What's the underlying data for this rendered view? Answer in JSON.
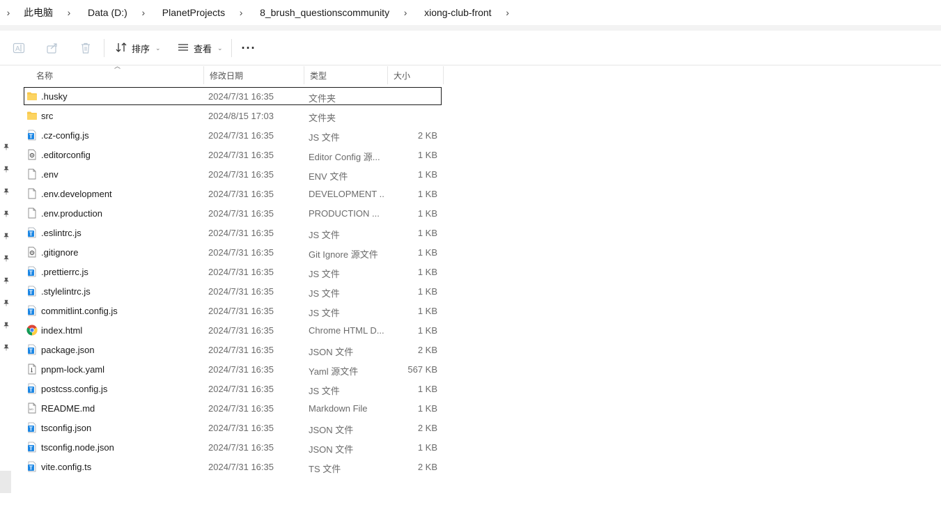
{
  "breadcrumb": {
    "items": [
      "此电脑",
      "Data (D:)",
      "PlanetProjects",
      "8_brush_questionscommunity",
      "xiong-club-front"
    ]
  },
  "toolbar": {
    "sort_label": "排序",
    "view_label": "查看",
    "more_label": "···"
  },
  "columns": {
    "name": "名称",
    "modified": "修改日期",
    "type": "类型",
    "size": "大小"
  },
  "files": [
    {
      "name": ".husky",
      "date": "2024/7/31 16:35",
      "type": "文件夹",
      "size": "",
      "icon": "folder-icon",
      "selected": true
    },
    {
      "name": "src",
      "date": "2024/8/15 17:03",
      "type": "文件夹",
      "size": "",
      "icon": "folder-icon"
    },
    {
      "name": ".cz-config.js",
      "date": "2024/7/31 16:35",
      "type": "JS 文件",
      "size": "2 KB",
      "icon": "script-file-icon"
    },
    {
      "name": ".editorconfig",
      "date": "2024/7/31 16:35",
      "type": "Editor Config 源...",
      "size": "1 KB",
      "icon": "config-file-icon"
    },
    {
      "name": ".env",
      "date": "2024/7/31 16:35",
      "type": "ENV 文件",
      "size": "1 KB",
      "icon": "blank-file-icon"
    },
    {
      "name": ".env.development",
      "date": "2024/7/31 16:35",
      "type": "DEVELOPMENT ...",
      "size": "1 KB",
      "icon": "blank-file-icon"
    },
    {
      "name": ".env.production",
      "date": "2024/7/31 16:35",
      "type": "PRODUCTION ...",
      "size": "1 KB",
      "icon": "blank-file-icon"
    },
    {
      "name": ".eslintrc.js",
      "date": "2024/7/31 16:35",
      "type": "JS 文件",
      "size": "1 KB",
      "icon": "script-file-icon"
    },
    {
      "name": ".gitignore",
      "date": "2024/7/31 16:35",
      "type": "Git Ignore 源文件",
      "size": "1 KB",
      "icon": "config-file-icon"
    },
    {
      "name": ".prettierrc.js",
      "date": "2024/7/31 16:35",
      "type": "JS 文件",
      "size": "1 KB",
      "icon": "script-file-icon"
    },
    {
      "name": ".stylelintrc.js",
      "date": "2024/7/31 16:35",
      "type": "JS 文件",
      "size": "1 KB",
      "icon": "script-file-icon"
    },
    {
      "name": "commitlint.config.js",
      "date": "2024/7/31 16:35",
      "type": "JS 文件",
      "size": "1 KB",
      "icon": "script-file-icon"
    },
    {
      "name": "index.html",
      "date": "2024/7/31 16:35",
      "type": "Chrome HTML D...",
      "size": "1 KB",
      "icon": "chrome-icon"
    },
    {
      "name": "package.json",
      "date": "2024/7/31 16:35",
      "type": "JSON 文件",
      "size": "2 KB",
      "icon": "script-file-icon"
    },
    {
      "name": "pnpm-lock.yaml",
      "date": "2024/7/31 16:35",
      "type": "Yaml 源文件",
      "size": "567 KB",
      "icon": "text-file-icon"
    },
    {
      "name": "postcss.config.js",
      "date": "2024/7/31 16:35",
      "type": "JS 文件",
      "size": "1 KB",
      "icon": "script-file-icon"
    },
    {
      "name": "README.md",
      "date": "2024/7/31 16:35",
      "type": "Markdown File",
      "size": "1 KB",
      "icon": "markdown-file-icon"
    },
    {
      "name": "tsconfig.json",
      "date": "2024/7/31 16:35",
      "type": "JSON 文件",
      "size": "2 KB",
      "icon": "script-file-icon"
    },
    {
      "name": "tsconfig.node.json",
      "date": "2024/7/31 16:35",
      "type": "JSON 文件",
      "size": "1 KB",
      "icon": "script-file-icon"
    },
    {
      "name": "vite.config.ts",
      "date": "2024/7/31 16:35",
      "type": "TS 文件",
      "size": "2 KB",
      "icon": "script-file-icon"
    }
  ],
  "colors": {
    "folder": "#f8c74a",
    "script_blue": "#1e88e5",
    "selection_outline": "#1a1a1a",
    "secondary_text": "#6b6b6b"
  }
}
